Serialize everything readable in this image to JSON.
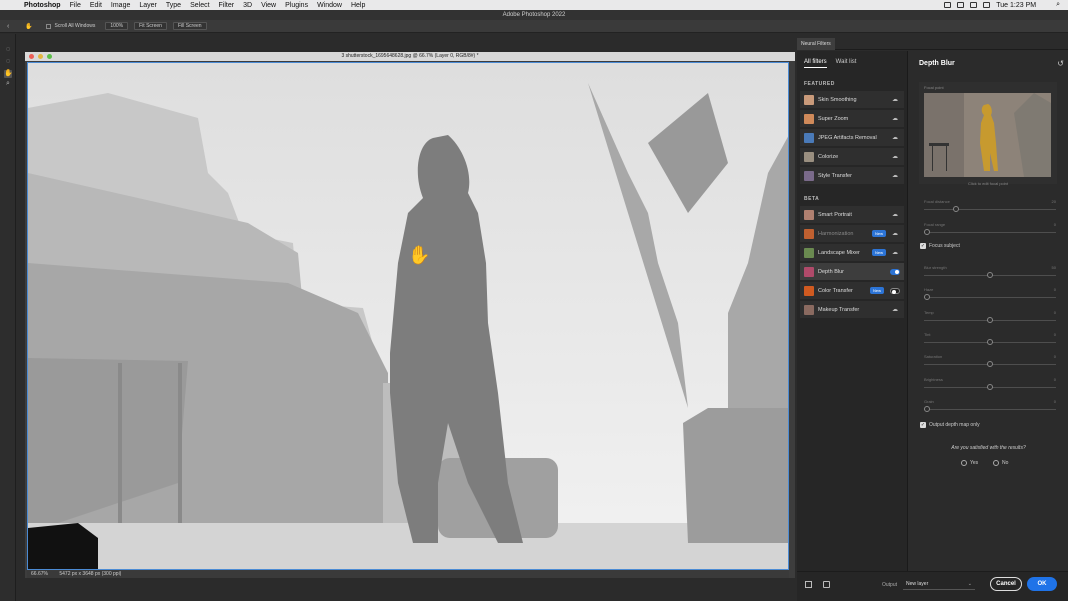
{
  "menubar": {
    "app": "Photoshop",
    "items": [
      "File",
      "Edit",
      "Image",
      "Layer",
      "Type",
      "Select",
      "Filter",
      "3D",
      "View",
      "Plugins",
      "Window",
      "Help"
    ],
    "clock": "Tue 1:23 PM"
  },
  "app_title": "Adobe Photoshop 2022",
  "options": {
    "scroll_all": "Scroll All Windows",
    "zoom_100": "100%",
    "fit_screen": "Fit Screen",
    "fill_screen": "Fill Screen"
  },
  "document": {
    "title": "3 shutterstock_1695648628.jpg @ 66.7% (Layer 0, RGB/8#) *",
    "zoom": "66.67%",
    "dimensions": "5472 px x 3648 px (300 ppi)"
  },
  "neural_filters": {
    "panel_tab": "Neural Filters",
    "tabs": [
      "All filters",
      "Wait list"
    ],
    "featured_label": "FEATURED",
    "beta_label": "BETA",
    "featured": [
      {
        "label": "Skin Smoothing",
        "color": "#c99a7a"
      },
      {
        "label": "Super Zoom",
        "color": "#d08a5a"
      },
      {
        "label": "JPEG Artifacts Removal",
        "color": "#4a7ab8"
      },
      {
        "label": "Colorize",
        "color": "#9a8f80"
      },
      {
        "label": "Style Transfer",
        "color": "#7a6a8a"
      }
    ],
    "beta": [
      {
        "label": "Smart Portrait",
        "color": "#b08070"
      },
      {
        "label": "Harmonization",
        "color": "#c06030",
        "badge": "New",
        "dim": true
      },
      {
        "label": "Landscape Mixer",
        "color": "#6a8a50",
        "badge": "New"
      },
      {
        "label": "Depth Blur",
        "color": "#b04a6a",
        "toggle": "on"
      },
      {
        "label": "Color Transfer",
        "color": "#d05a20",
        "badge": "New",
        "toggle": "off"
      },
      {
        "label": "Makeup Transfer",
        "color": "#8a6a60"
      }
    ]
  },
  "depth_blur": {
    "title": "Depth Blur",
    "focal_point_label": "Focal point",
    "focal_caption": "Click to edit focal point",
    "sliders": [
      {
        "label": "Focal distance",
        "value": "20",
        "pos": 0.23
      },
      {
        "label": "Focal range",
        "value": "0",
        "pos": 0.0
      }
    ],
    "focus_subject": "Focus subject",
    "sliders2": [
      {
        "label": "Blur strength",
        "value": "50",
        "pos": 0.5
      },
      {
        "label": "Haze",
        "value": "0",
        "pos": 0.0
      },
      {
        "label": "Temp",
        "value": "0",
        "pos": 0.5
      },
      {
        "label": "Tint",
        "value": "0",
        "pos": 0.5
      },
      {
        "label": "Saturation",
        "value": "0",
        "pos": 0.5
      },
      {
        "label": "Brightness",
        "value": "0",
        "pos": 0.5
      },
      {
        "label": "Grain",
        "value": "0",
        "pos": 0.0
      }
    ],
    "output_depth": "Output depth map only",
    "question": "Are you satisfied with the results?",
    "yes": "Yes",
    "no": "No"
  },
  "bottom": {
    "output_label": "Output",
    "output_value": "New layer",
    "cancel": "Cancel",
    "ok": "OK"
  }
}
